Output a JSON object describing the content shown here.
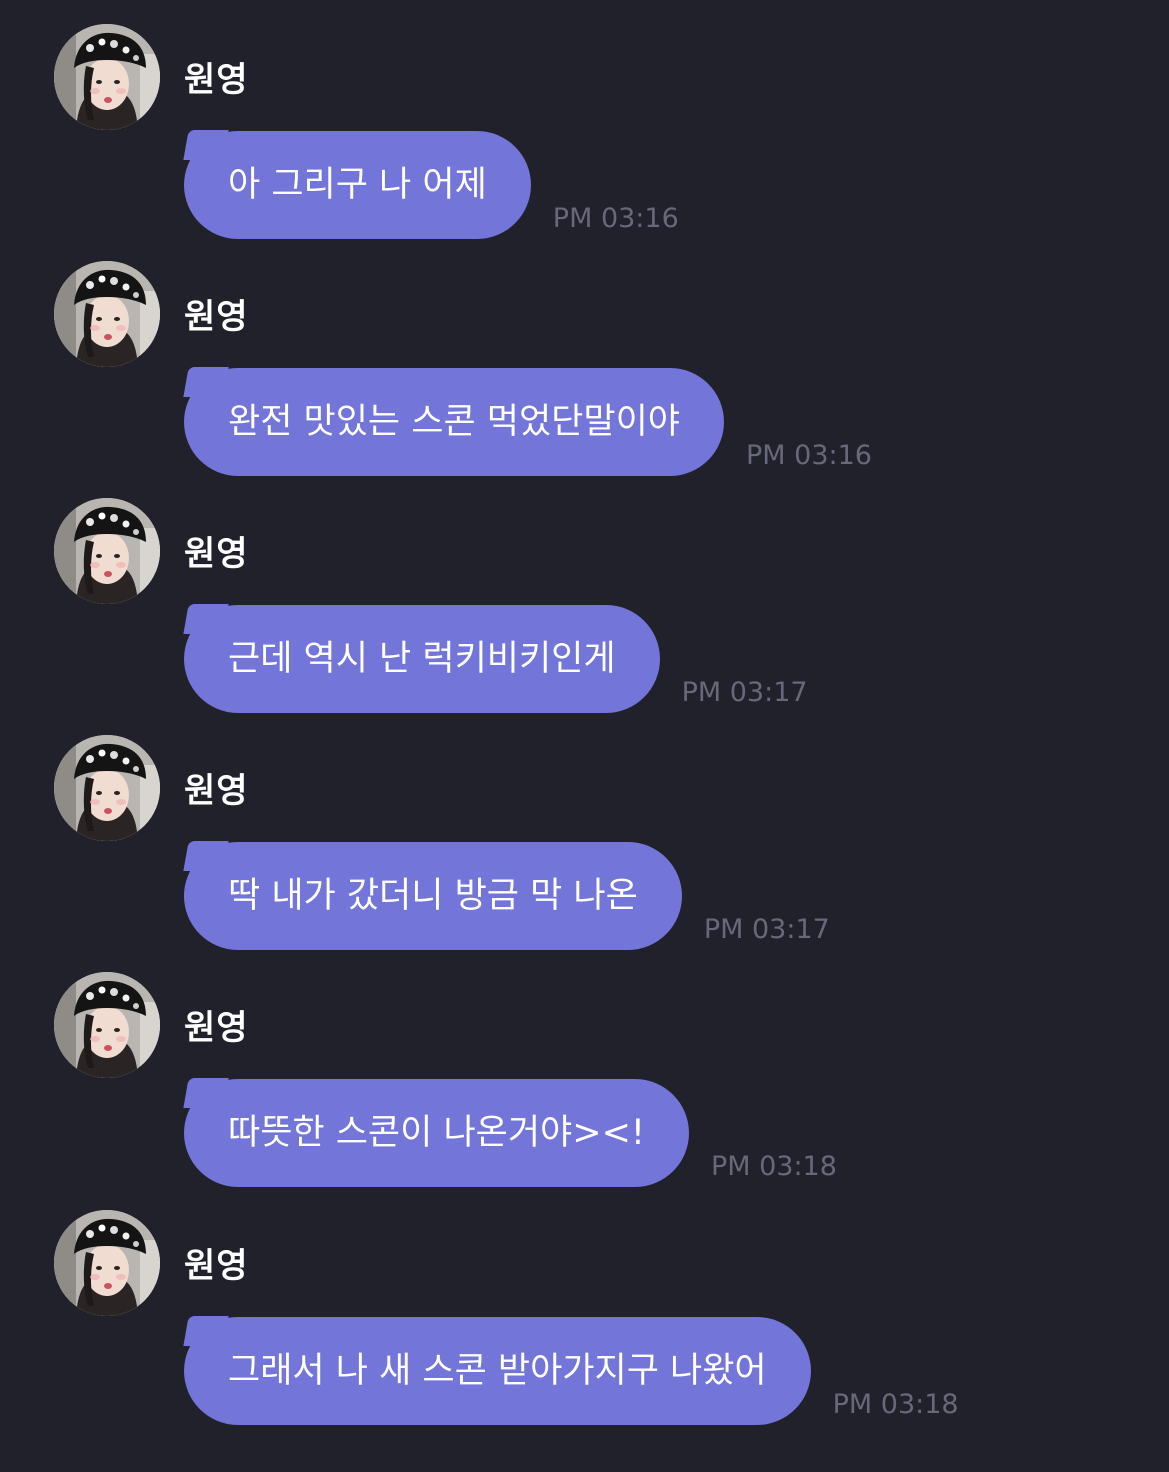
{
  "chat": {
    "messages": [
      {
        "sender": "원영",
        "avatar_icon": "profile-photo",
        "text": "아 그리구 나 어제",
        "time": "PM 03:16"
      },
      {
        "sender": "원영",
        "avatar_icon": "profile-photo",
        "text": "완전 맛있는 스콘 먹었단말이야",
        "time": "PM 03:16"
      },
      {
        "sender": "원영",
        "avatar_icon": "profile-photo",
        "text": "근데 역시 난 럭키비키인게",
        "time": "PM 03:17"
      },
      {
        "sender": "원영",
        "avatar_icon": "profile-photo",
        "text": "딱 내가 갔더니 방금 막 나온",
        "time": "PM 03:17"
      },
      {
        "sender": "원영",
        "avatar_icon": "profile-photo",
        "text": "따뜻한 스콘이 나온거야><!",
        "time": "PM 03:18"
      },
      {
        "sender": "원영",
        "avatar_icon": "profile-photo",
        "text": "그래서 나 새 스콘 받아가지구 나왔어",
        "time": "PM 03:18"
      }
    ]
  },
  "colors": {
    "background": "#20212b",
    "bubble": "#7375d8",
    "timestamp": "#67687a",
    "text": "#ffffff"
  }
}
